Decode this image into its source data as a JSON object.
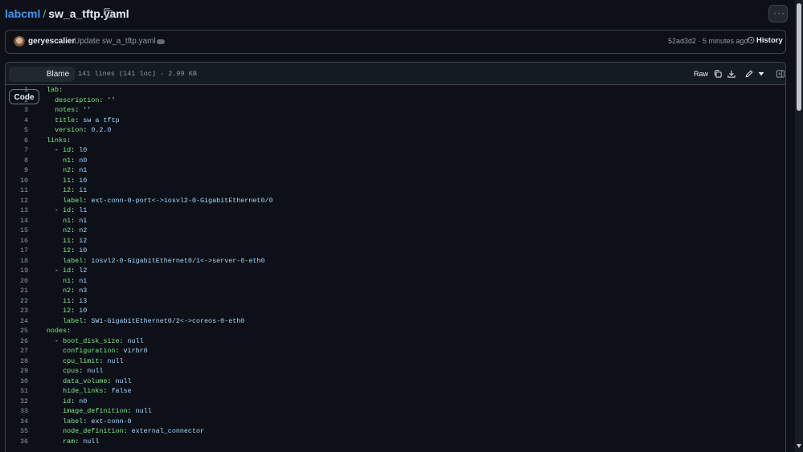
{
  "breadcrumb": {
    "repo": "labcml",
    "separator": "/",
    "file": "sw_a_tftp.yaml"
  },
  "commit": {
    "author": "geryescalier",
    "message": "Update sw_a_tftp.yaml",
    "sha_time": "52ad3d2 · 5 minutes ago",
    "history_label": "History"
  },
  "file": {
    "tabs": {
      "code": "Code",
      "blame": "Blame"
    },
    "info": "141 lines (141 loc) · 2.99 KB",
    "raw_label": "Raw"
  },
  "colors": {
    "bg": "#0d1117",
    "key": "#7ee787",
    "value": "#a5d6ff",
    "link": "#4493f8"
  },
  "code_lines": [
    {
      "n": "1",
      "key": "lab",
      "sep": ":",
      "val": ""
    },
    {
      "n": "2",
      "key": "  description",
      "sep": ": ",
      "val": "''"
    },
    {
      "n": "3",
      "key": "  notes",
      "sep": ": ",
      "val": "''"
    },
    {
      "n": "4",
      "key": "  title",
      "sep": ": ",
      "val": "sw a tftp"
    },
    {
      "n": "5",
      "key": "  version",
      "sep": ": ",
      "val": "0.2.0"
    },
    {
      "n": "6",
      "key": "links",
      "sep": ":",
      "val": ""
    },
    {
      "n": "7",
      "key": "  - id",
      "sep": ": ",
      "val": "l0"
    },
    {
      "n": "8",
      "key": "    n1",
      "sep": ": ",
      "val": "n0"
    },
    {
      "n": "9",
      "key": "    n2",
      "sep": ": ",
      "val": "n1"
    },
    {
      "n": "10",
      "key": "    i1",
      "sep": ": ",
      "val": "i0"
    },
    {
      "n": "11",
      "key": "    i2",
      "sep": ": ",
      "val": "i1"
    },
    {
      "n": "12",
      "key": "    label",
      "sep": ": ",
      "val": "ext-conn-0-port<->iosvl2-0-GigabitEthernet0/0"
    },
    {
      "n": "13",
      "key": "  - id",
      "sep": ": ",
      "val": "l1"
    },
    {
      "n": "14",
      "key": "    n1",
      "sep": ": ",
      "val": "n1"
    },
    {
      "n": "15",
      "key": "    n2",
      "sep": ": ",
      "val": "n2"
    },
    {
      "n": "16",
      "key": "    i1",
      "sep": ": ",
      "val": "i2"
    },
    {
      "n": "17",
      "key": "    i2",
      "sep": ": ",
      "val": "i0"
    },
    {
      "n": "18",
      "key": "    label",
      "sep": ": ",
      "val": "iosvl2-0-GigabitEthernet0/1<->server-0-eth0"
    },
    {
      "n": "19",
      "key": "  - id",
      "sep": ": ",
      "val": "l2"
    },
    {
      "n": "20",
      "key": "    n1",
      "sep": ": ",
      "val": "n1"
    },
    {
      "n": "21",
      "key": "    n2",
      "sep": ": ",
      "val": "n3"
    },
    {
      "n": "22",
      "key": "    i1",
      "sep": ": ",
      "val": "i3"
    },
    {
      "n": "23",
      "key": "    i2",
      "sep": ": ",
      "val": "i0"
    },
    {
      "n": "24",
      "key": "    label",
      "sep": ": ",
      "val": "SW1-GigabitEthernet0/2<->coreos-0-eth0"
    },
    {
      "n": "25",
      "key": "nodes",
      "sep": ":",
      "val": ""
    },
    {
      "n": "26",
      "key": "  - boot_disk_size",
      "sep": ": ",
      "val": "null"
    },
    {
      "n": "27",
      "key": "    configuration",
      "sep": ": ",
      "val": "virbr0"
    },
    {
      "n": "28",
      "key": "    cpu_limit",
      "sep": ": ",
      "val": "null"
    },
    {
      "n": "29",
      "key": "    cpus",
      "sep": ": ",
      "val": "null"
    },
    {
      "n": "30",
      "key": "    data_volume",
      "sep": ": ",
      "val": "null"
    },
    {
      "n": "31",
      "key": "    hide_links",
      "sep": ": ",
      "val": "false"
    },
    {
      "n": "32",
      "key": "    id",
      "sep": ": ",
      "val": "n0"
    },
    {
      "n": "33",
      "key": "    image_definition",
      "sep": ": ",
      "val": "null"
    },
    {
      "n": "34",
      "key": "    label",
      "sep": ": ",
      "val": "ext-conn-0"
    },
    {
      "n": "35",
      "key": "    node_definition",
      "sep": ": ",
      "val": "external_connector"
    },
    {
      "n": "36",
      "key": "    ram",
      "sep": ": ",
      "val": "null"
    }
  ]
}
